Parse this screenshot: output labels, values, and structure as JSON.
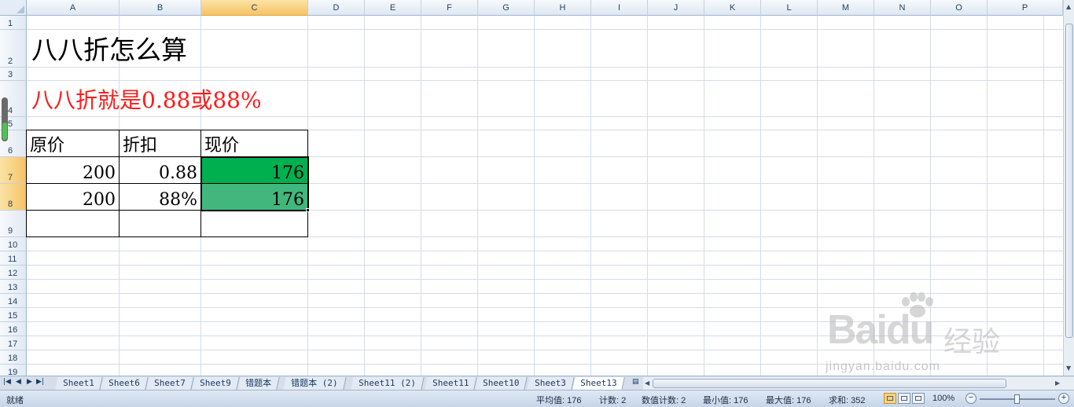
{
  "columns": [
    "A",
    "B",
    "C",
    "D",
    "E",
    "F",
    "G",
    "H",
    "I",
    "J",
    "K",
    "L",
    "M",
    "N",
    "O",
    "P"
  ],
  "rows": [
    "1",
    "2",
    "3",
    "4",
    "5",
    "6",
    "7",
    "8",
    "9",
    "10",
    "11",
    "12",
    "13",
    "14",
    "15",
    "16",
    "17",
    "18",
    "19"
  ],
  "selected_column": "C",
  "selected_rows": [
    "7",
    "8"
  ],
  "cells": {
    "title": "八八折怎么算",
    "subtitle": "八八折就是0.88或88%",
    "table": {
      "headers": [
        "原价",
        "折扣",
        "现价"
      ],
      "rows": [
        [
          "200",
          "0.88",
          "176"
        ],
        [
          "200",
          "88%",
          "176"
        ]
      ]
    }
  },
  "colors": {
    "cell_green_dark": "#00b04f",
    "cell_green_light": "#41b77d",
    "subtitle_red": "#ff1b1b"
  },
  "sheet_tabs": [
    "Sheet1",
    "Sheet6",
    "Sheet7",
    "Sheet9",
    "错题本",
    "错题本 (2)",
    "Sheet11 (2)",
    "Sheet11",
    "Sheet10",
    "Sheet3",
    "Sheet13"
  ],
  "active_sheet": "Sheet13",
  "status": {
    "ready": "就绪",
    "average": "平均值: 176",
    "count": "计数: 2",
    "numeric_count": "数值计数: 2",
    "min": "最小值: 176",
    "max": "最大值: 176",
    "sum": "求和: 352",
    "zoom": "100%",
    "zoom_minus": "−",
    "zoom_plus": "+"
  },
  "watermark": {
    "brand": "Bai",
    "brand2": "du",
    "jingyan": "经验",
    "url": "jingyan.baidu.com"
  },
  "icons": {
    "nav_first": "first-sheet-icon",
    "nav_prev": "prev-sheet-icon",
    "nav_next": "next-sheet-icon",
    "nav_last": "last-sheet-icon"
  }
}
